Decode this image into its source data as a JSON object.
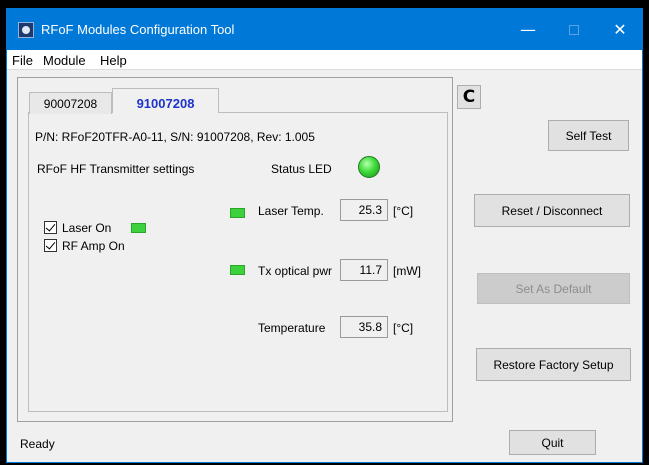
{
  "window": {
    "title": "RFoF Modules Configuration Tool",
    "minimize_glyph": "—",
    "close_glyph": "✕"
  },
  "menu": {
    "items": [
      {
        "label": "File"
      },
      {
        "label": "Module"
      },
      {
        "label": "Help"
      }
    ]
  },
  "tabs": [
    {
      "label": "90007208",
      "active": false
    },
    {
      "label": "91007208",
      "active": true
    }
  ],
  "module": {
    "info": "P/N: RFoF20TFR-A0-11, S/N: 91007208, Rev: 1.005",
    "section_label": "RFoF HF Transmitter settings",
    "status_led_label": "Status LED",
    "laser_on_label": "Laser On",
    "laser_on_checked": true,
    "rf_amp_label": "RF Amp On",
    "rf_amp_checked": true,
    "laser_temp_label": "Laser Temp.",
    "laser_temp_value": "25.3",
    "laser_temp_unit": "[°C]",
    "tx_power_label": "Tx optical pwr",
    "tx_power_value": "11.7",
    "tx_power_unit": "[mW]",
    "temperature_label": "Temperature",
    "temperature_value": "35.8",
    "temperature_unit": "[°C]"
  },
  "buttons": {
    "self_test": "Self Test",
    "reset_disconnect": "Reset / Disconnect",
    "set_as_default": "Set As Default",
    "restore_factory": "Restore Factory Setup",
    "quit": "Quit",
    "refresh_glyph": "C"
  },
  "statusbar": {
    "text": "Ready"
  },
  "colors": {
    "titlebar": "#0078d7",
    "active_tab_text": "#1d34c8",
    "led_green": "#3ed13e"
  }
}
